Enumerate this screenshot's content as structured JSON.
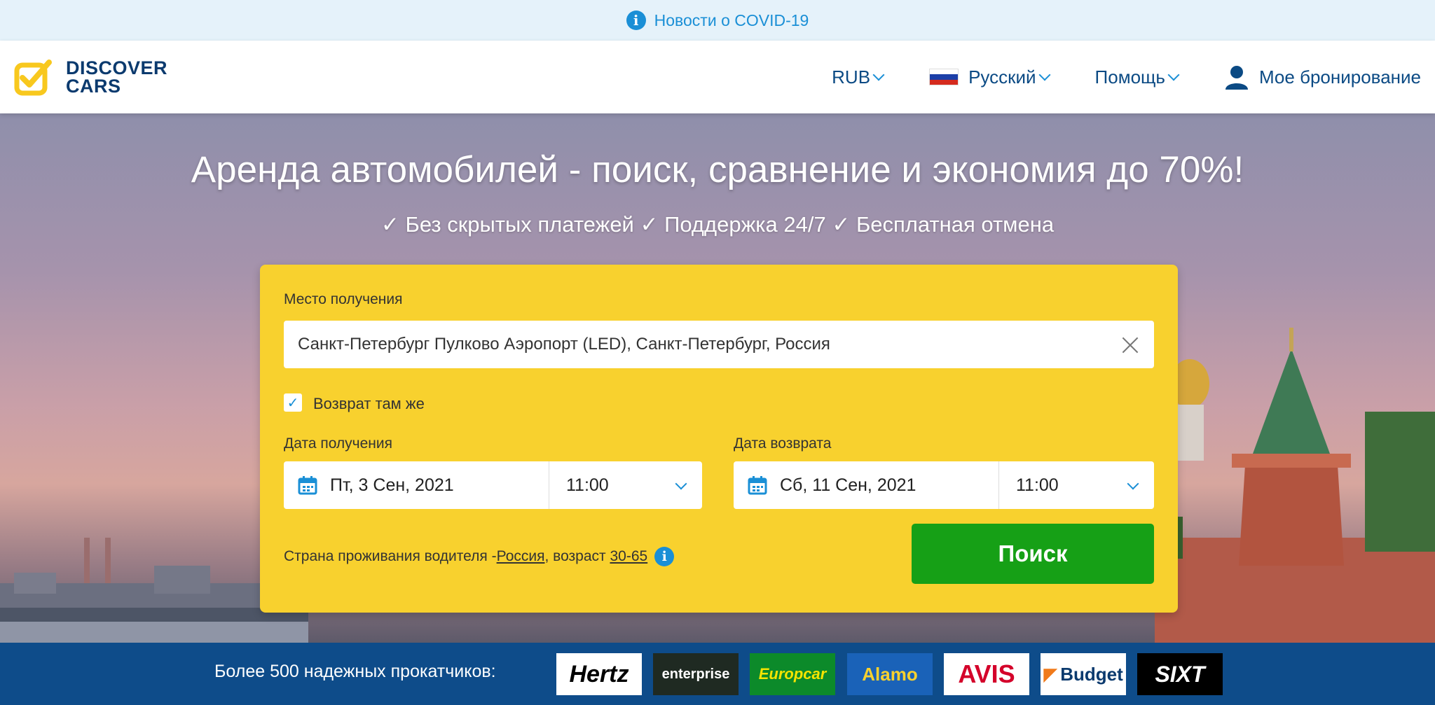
{
  "banner": {
    "text": "Новости о COVID-19"
  },
  "header": {
    "logo_line1": "DISCOVER",
    "logo_line2": "CARS",
    "currency": "RUB",
    "language": "Русский",
    "help": "Помощь",
    "my_booking": "Мое бронирование"
  },
  "hero": {
    "title": "Аренда автомобилей - поиск, сравнение и экономия до 70%!",
    "subtitle": "✓ Без скрытых платежей ✓ Поддержка 24/7 ✓ Бесплатная отмена"
  },
  "search": {
    "pickup_label": "Место получения",
    "pickup_value": "Санкт-Петербург Пулково Аэропорт (LED), Санкт-Петербург, Россия",
    "same_return_label": "Возврат там же",
    "pickup_date_label": "Дата получения",
    "pickup_date": "Пт, 3 Сен, 2021",
    "pickup_time": "11:00",
    "return_date_label": "Дата возврата",
    "return_date": "Сб, 11 Сен, 2021",
    "return_time": "11:00",
    "residence_prefix": "Страна проживания водителя - ",
    "residence_country": "Россия",
    "age_prefix": ", возраст ",
    "age_range": "30-65",
    "search_button": "Поиск"
  },
  "partners": {
    "label": "Более 500 надежных прокатчиков:",
    "brands": [
      "Hertz",
      "enterprise",
      "Europcar",
      "Alamo",
      "AVIS",
      "Budget",
      "SIXT"
    ]
  },
  "colors": {
    "accent_blue": "#1a8fd6",
    "navy": "#0b3a6e",
    "search_yellow": "#f8d12e",
    "search_green": "#16a016",
    "partners_bar": "#0e4c8a"
  }
}
